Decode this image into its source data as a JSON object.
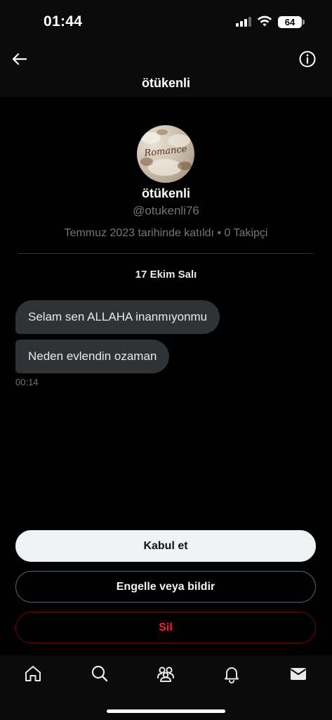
{
  "status_bar": {
    "time": "01:44",
    "battery": "64"
  },
  "header": {
    "title": "ötükenli",
    "back_icon": "arrow-left-icon",
    "info_icon": "info-circle-icon"
  },
  "profile": {
    "avatar_text": "Romance",
    "name": "ötükenli",
    "handle": "@otukenli76",
    "meta": "Temmuz 2023 tarihinde katıldı • 0 Takipçi"
  },
  "conversation": {
    "date": "17 Ekim Salı",
    "messages": [
      {
        "text": "Selam sen ALLAHA inanmıyonmu"
      },
      {
        "text": "Neden evlendin ozaman"
      }
    ],
    "time": "00:14"
  },
  "actions": {
    "accept": "Kabul et",
    "block_or_report": "Engelle veya bildir",
    "delete": "Sil"
  },
  "tab_bar": {
    "items": [
      {
        "icon": "home-icon"
      },
      {
        "icon": "search-icon"
      },
      {
        "icon": "communities-icon"
      },
      {
        "icon": "bell-icon"
      },
      {
        "icon": "mail-icon"
      }
    ]
  },
  "colors": {
    "background": "#000000",
    "bubble": "#2f3336",
    "muted_text": "#71767b",
    "danger": "#f4212e"
  }
}
